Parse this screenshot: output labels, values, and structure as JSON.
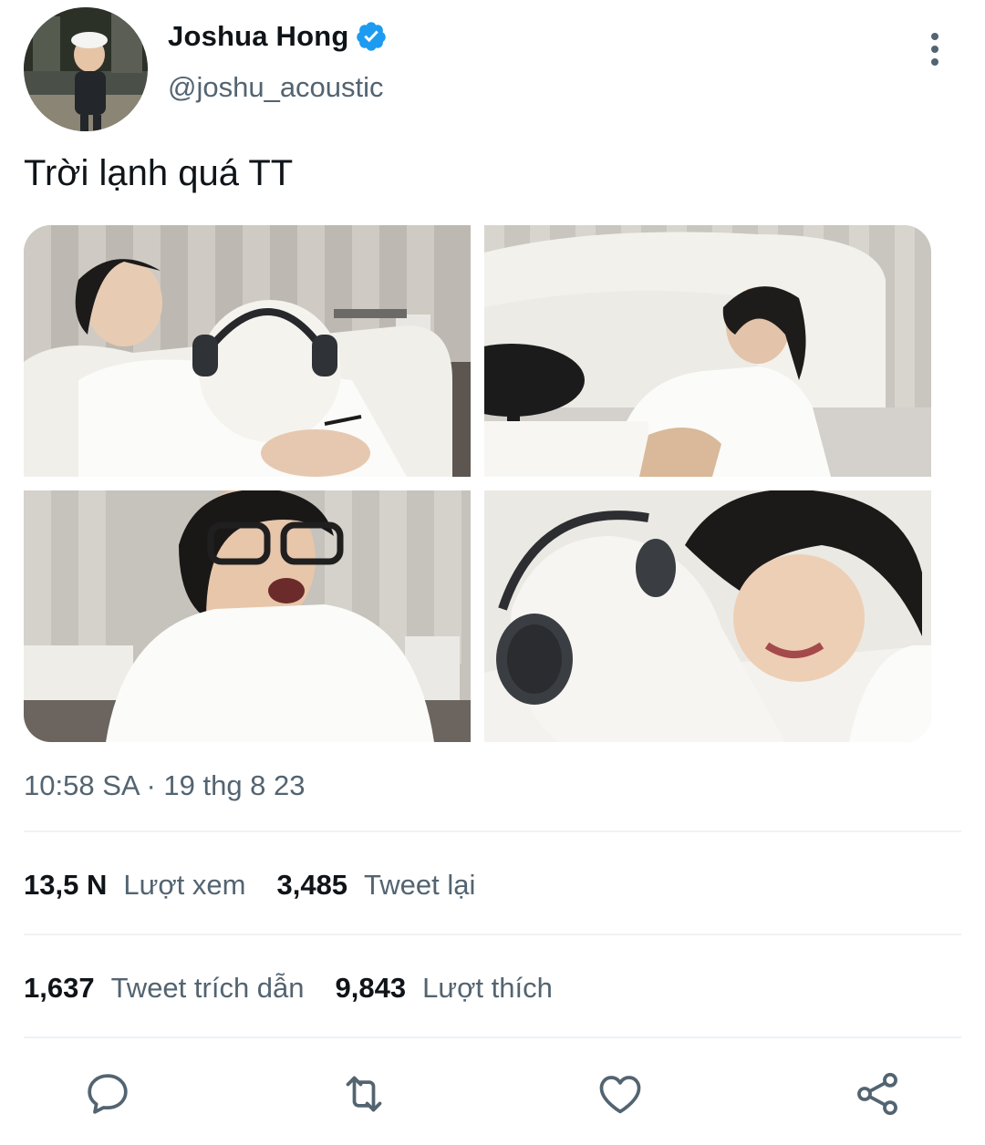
{
  "tweet": {
    "author_name": "Joshua Hong",
    "handle": "@joshu_acoustic",
    "verified": true,
    "text": "Trời lạnh quá TT",
    "timestamp": "10:58 SA · 19 thg 8 23",
    "media_count": 4
  },
  "stats": {
    "views_count": "13,5 N",
    "views_label": "Lượt xem",
    "retweets_count": "3,485",
    "retweets_label": "Tweet lại",
    "quotes_count": "1,637",
    "quotes_label": "Tweet trích dẫn",
    "likes_count": "9,843",
    "likes_label": "Lượt thích"
  },
  "icons": {
    "verified": "verified-badge-icon",
    "more": "more-vertical-icon",
    "reply": "reply-icon",
    "retweet": "retweet-icon",
    "like": "heart-icon",
    "share": "share-icon"
  },
  "colors": {
    "verified_blue": "#1d9bf0",
    "text_primary": "#0f1419",
    "text_secondary": "#536471",
    "divider": "#eff3f4"
  }
}
